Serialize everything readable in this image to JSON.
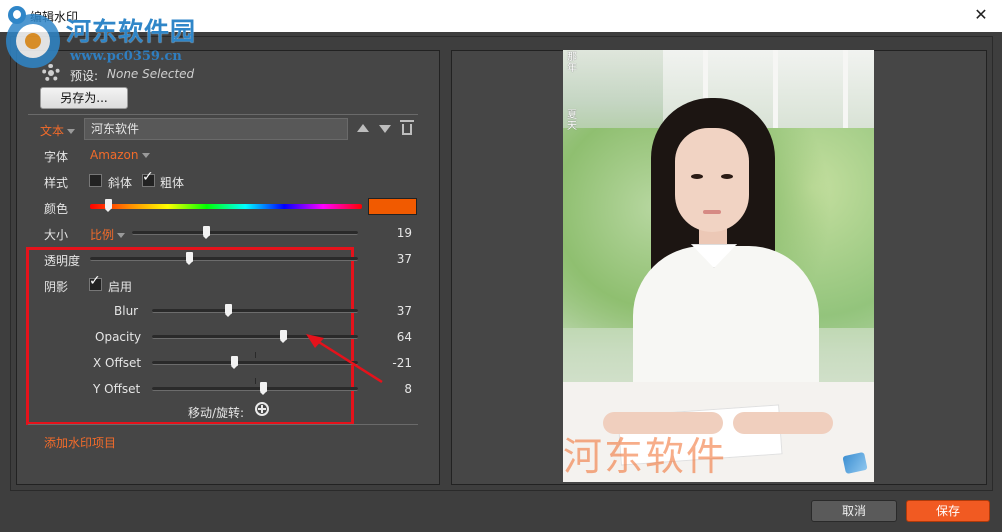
{
  "window": {
    "title": "编辑水印",
    "close_glyph": "✕"
  },
  "watermark_overlay": {
    "site_name": "河东软件园",
    "site_url": "www.pc0359.cn"
  },
  "preset": {
    "label": "预设:",
    "value": "None Selected",
    "save_as_button": "另存为..."
  },
  "item": {
    "type_label": "文本",
    "text_value": "河东软件",
    "font_label": "字体",
    "font_value": "Amazon",
    "style_label": "样式",
    "italic_label": "斜体",
    "italic_checked": false,
    "bold_label": "粗体",
    "bold_checked": true,
    "color_label": "颜色",
    "color_value": "#f15a00",
    "size_label": "大小",
    "size_mode": "比例",
    "size_value": "19",
    "size_fraction": 0.33
  },
  "opacity": {
    "label": "透明度",
    "value": "37",
    "fraction": 0.37
  },
  "shadow": {
    "label": "阴影",
    "enabled_label": "启用",
    "enabled": true,
    "blur": {
      "label": "Blur",
      "value": "37",
      "fraction": 0.37
    },
    "opacity": {
      "label": "Opacity",
      "value": "64",
      "fraction": 0.64
    },
    "x_offset": {
      "label": "X Offset",
      "value": "-21",
      "fraction": 0.4
    },
    "y_offset": {
      "label": "Y Offset",
      "value": "8",
      "fraction": 0.54
    },
    "move_rotate_label": "移动/旋转:"
  },
  "add_item_label": "添加水印项目",
  "preview": {
    "watermark_text": "河东软件",
    "photo_vertical_text_1": "那年",
    "photo_vertical_text_2": "夏天"
  },
  "footer": {
    "cancel_label": "取消",
    "save_label": "保存"
  },
  "colors": {
    "accent": "#f26b2a",
    "highlight_box": "#e5121b",
    "save_button": "#f15a22",
    "panel_bg": "#464646"
  }
}
